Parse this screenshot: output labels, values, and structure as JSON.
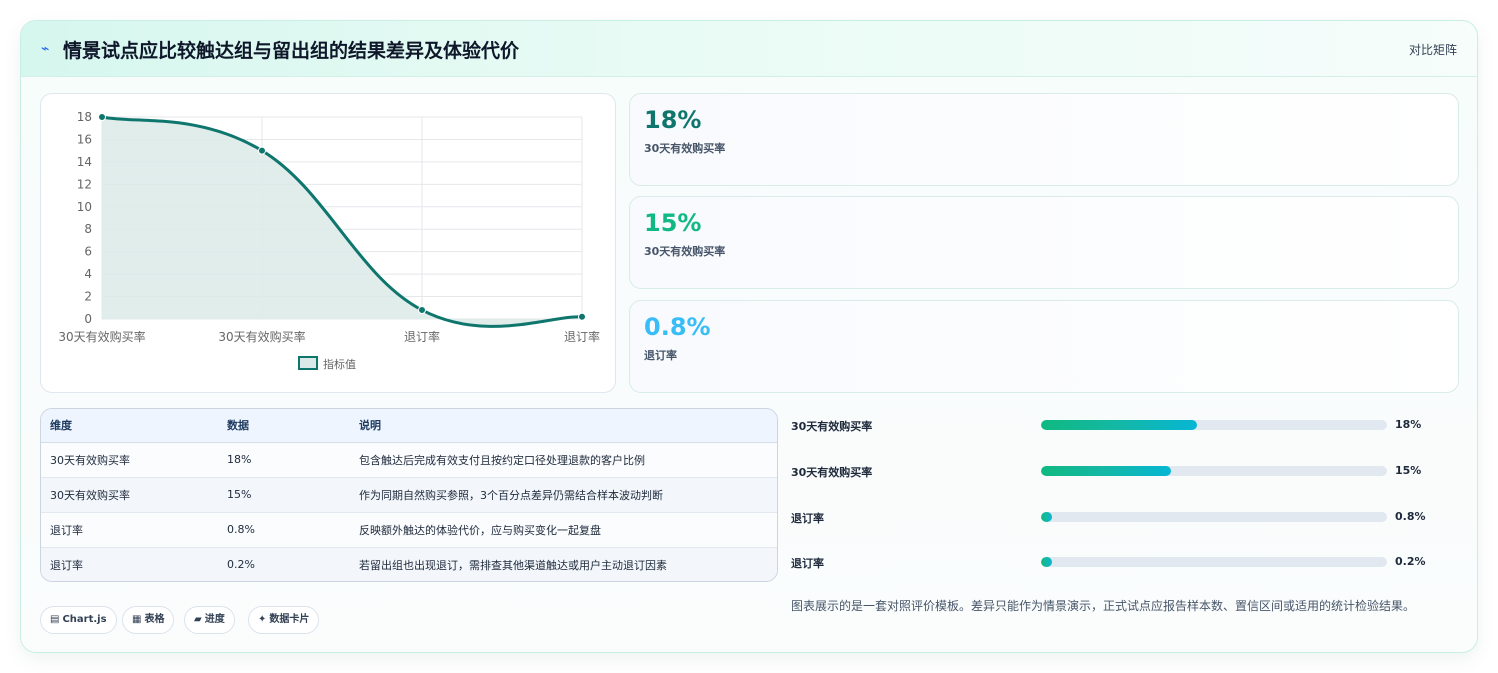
{
  "header": {
    "icon": "chart-bolt-icon",
    "title": "情景试点应比较触达组与留出组的结果差异及体验代价",
    "right_label": "对比矩阵"
  },
  "chart_data": {
    "type": "area",
    "categories": [
      "30天有效购买率",
      "30天有效购买率",
      "退订率",
      "退订率"
    ],
    "series": [
      {
        "name": "指标值",
        "values": [
          18,
          15,
          0.8,
          0.2
        ]
      }
    ],
    "ylim": [
      0,
      18
    ],
    "yticks": [
      0,
      2,
      4,
      6,
      8,
      10,
      12,
      14,
      16,
      18
    ],
    "grid": true,
    "legend": "bottom",
    "colors": {
      "line": "#0f766e",
      "fill": "#dbeae8"
    }
  },
  "stats": [
    {
      "value": "18%",
      "label": "30天有效购买率",
      "color": "#0f766e"
    },
    {
      "value": "15%",
      "label": "30天有效购买率",
      "color": "#10b981"
    },
    {
      "value": "0.8%",
      "label": "退订率",
      "color": "#38bdf8"
    }
  ],
  "table": {
    "headers": [
      "维度",
      "数据",
      "说明"
    ],
    "rows": [
      [
        "30天有效购买率",
        "18%",
        "包含触达后完成有效支付且按约定口径处理退款的客户比例"
      ],
      [
        "30天有效购买率",
        "15%",
        "作为同期自然购买参照，3个百分点差异仍需结合样本波动判断"
      ],
      [
        "退订率",
        "0.8%",
        "反映额外触达的体验代价，应与购买变化一起复盘"
      ],
      [
        "退订率",
        "0.2%",
        "若留出组也出现退订，需排查其他渠道触达或用户主动退订因素"
      ]
    ]
  },
  "chips": [
    {
      "icon": "▤",
      "label": "Chart.js"
    },
    {
      "icon": "▦",
      "label": "表格"
    },
    {
      "icon": "▰",
      "label": "进度"
    },
    {
      "icon": "✦",
      "label": "数据卡片"
    }
  ],
  "progress": [
    {
      "label": "30天有效购买率",
      "value": "18%",
      "fraction": 0.45
    },
    {
      "label": "30天有效购买率",
      "value": "15%",
      "fraction": 0.375
    },
    {
      "label": "退订率",
      "value": "0.8%",
      "fraction": 0.02
    },
    {
      "label": "退订率",
      "value": "0.2%",
      "fraction": 0.005
    }
  ],
  "note": "图表展示的是一套对照评价模板。差异只能作为情景演示，正式试点应报告样本数、置信区间或适用的统计检验结果。"
}
